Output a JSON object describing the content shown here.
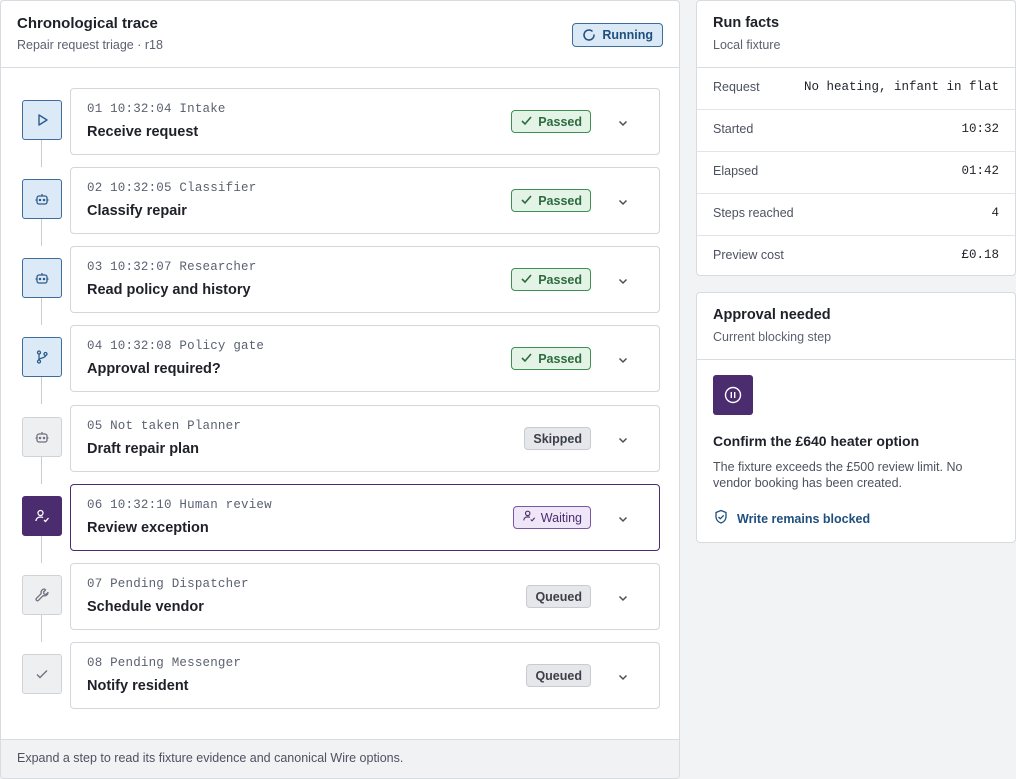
{
  "trace": {
    "title": "Chronological trace",
    "subtitle": "Repair request triage · r18",
    "status": "Running",
    "footer": "Expand a step to read its fixture evidence and canonical Wire options."
  },
  "steps": [
    {
      "meta": "01 10:32:04 Intake",
      "title": "Receive request",
      "status": "Passed",
      "icon": "play-icon"
    },
    {
      "meta": "02 10:32:05 Classifier",
      "title": "Classify repair",
      "status": "Passed",
      "icon": "robot-icon"
    },
    {
      "meta": "03 10:32:07 Researcher",
      "title": "Read policy and history",
      "status": "Passed",
      "icon": "robot-icon"
    },
    {
      "meta": "04 10:32:08 Policy gate",
      "title": "Approval required?",
      "status": "Passed",
      "icon": "branch-icon"
    },
    {
      "meta": "05 Not taken Planner",
      "title": "Draft repair plan",
      "status": "Skipped",
      "icon": "robot-icon"
    },
    {
      "meta": "06 10:32:10 Human review",
      "title": "Review exception",
      "status": "Waiting",
      "icon": "user-check-icon"
    },
    {
      "meta": "07 Pending Dispatcher",
      "title": "Schedule vendor",
      "status": "Queued",
      "icon": "wrench-icon"
    },
    {
      "meta": "08 Pending Messenger",
      "title": "Notify resident",
      "status": "Queued",
      "icon": "check-icon"
    }
  ],
  "facts": {
    "title": "Run facts",
    "subtitle": "Local fixture",
    "rows": [
      {
        "label": "Request",
        "value": "No heating, infant in flat"
      },
      {
        "label": "Started",
        "value": "10:32"
      },
      {
        "label": "Elapsed",
        "value": "01:42"
      },
      {
        "label": "Steps reached",
        "value": "4"
      },
      {
        "label": "Preview cost",
        "value": "£0.18"
      }
    ]
  },
  "approval": {
    "title": "Approval needed",
    "subtitle": "Current blocking step",
    "heading": "Confirm the £640 heater option",
    "body": "The fixture exceeds the £500 review limit. No vendor booking has been created.",
    "link": "Write remains blocked"
  },
  "colors": {
    "accent_blue": "#2c5c8a",
    "waiting_purple": "#4b2d6f",
    "passed_green": "#3f8f55"
  }
}
